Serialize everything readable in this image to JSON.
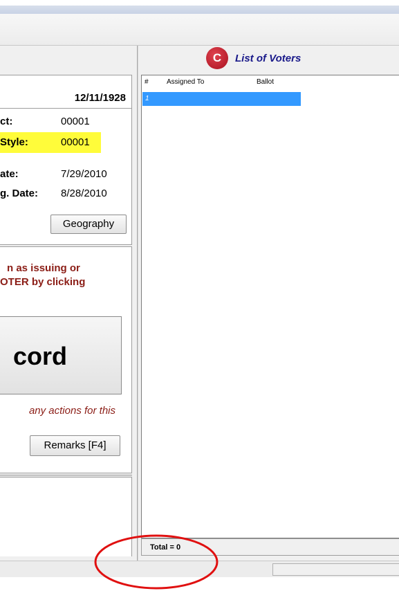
{
  "info": {
    "date": "12/11/1928",
    "precinct_label": "ct:",
    "precinct_value": "00001",
    "ballot_style_label": "Style:",
    "ballot_style_value": "00001",
    "date1_label": "ate:",
    "date1_value": "7/29/2010",
    "date2_label": "g. Date:",
    "date2_value": "8/28/2010",
    "geography_button": "Geography"
  },
  "action": {
    "msg_line1": "n as issuing or",
    "msg_line2": "OTER by clicking",
    "record_button": "cord",
    "italic_msg": "any actions for this",
    "remarks_button": "Remarks [F4]"
  },
  "voters": {
    "badge_letter": "C",
    "title": "List of Voters",
    "columns": [
      "#",
      "Assigned To",
      "Ballot"
    ],
    "rows": [
      {
        "num": "1",
        "assigned_to": "",
        "ballot": ""
      }
    ],
    "total": "Total = 0"
  },
  "colors": {
    "highlight": "#fffc3a",
    "selected_row": "#3399ff",
    "message_red": "#8b1d16",
    "title_blue": "#1a1a8a",
    "annotation_red": "#e01010"
  }
}
